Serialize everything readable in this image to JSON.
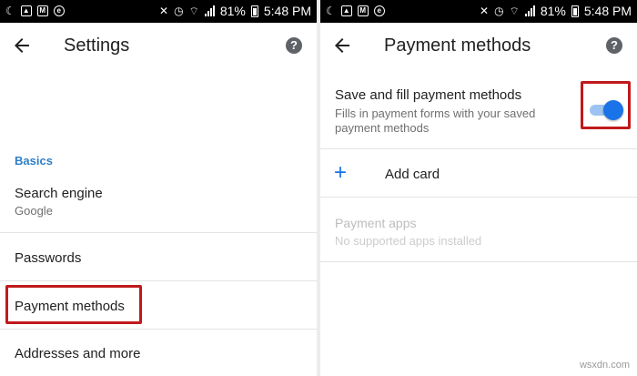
{
  "status_bar": {
    "battery_percent": "81%",
    "time": "5:48 PM"
  },
  "settings_screen": {
    "title": "Settings",
    "section": "Basics",
    "items": [
      {
        "title": "Search engine",
        "subtitle": "Google"
      },
      {
        "title": "Passwords"
      },
      {
        "title": "Payment methods"
      },
      {
        "title": "Addresses and more"
      }
    ]
  },
  "payment_screen": {
    "title": "Payment methods",
    "toggle_row": {
      "title": "Save and fill payment methods",
      "subtitle_line1": "Fills in payment forms with your saved",
      "subtitle_line2": "payment methods",
      "enabled": true
    },
    "add_card": "Add card",
    "payment_apps": {
      "title": "Payment apps",
      "subtitle": "No supported apps installed"
    }
  },
  "colors": {
    "accent": "#1a73e8",
    "section_label": "#2f7fc7",
    "highlight_box": "#c0191b"
  },
  "watermark": "wsxdn.com"
}
